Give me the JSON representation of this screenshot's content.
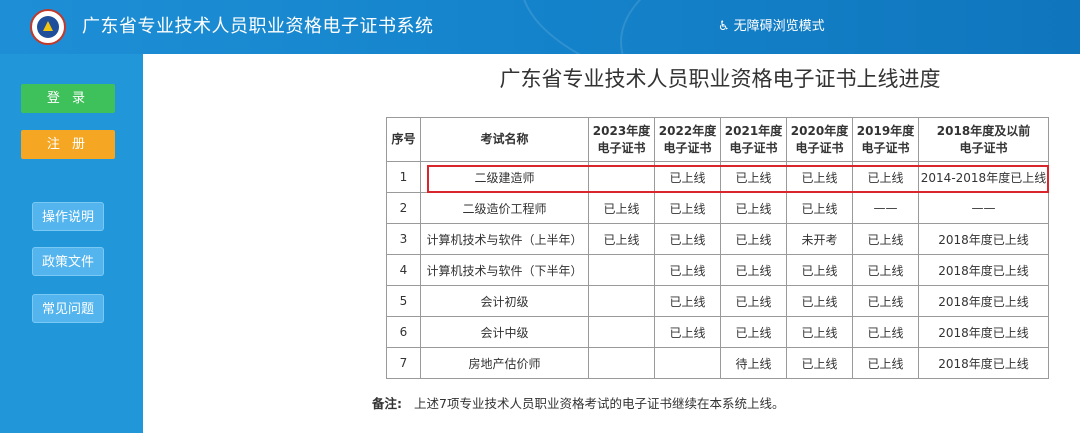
{
  "header": {
    "title": "广东省专业技术人员职业资格电子证书系统",
    "accessibility_label": "无障碍浏览模式"
  },
  "sidebar": {
    "login_label": "登 录",
    "register_label": "注 册",
    "nav": [
      "操作说明",
      "政策文件",
      "常见问题"
    ]
  },
  "main": {
    "title": "广东省专业技术人员职业资格电子证书上线进度",
    "table": {
      "headers": [
        {
          "line1": "序号",
          "line2": ""
        },
        {
          "line1": "考试名称",
          "line2": ""
        },
        {
          "line1": "2023年度",
          "line2": "电子证书"
        },
        {
          "line1": "2022年度",
          "line2": "电子证书"
        },
        {
          "line1": "2021年度",
          "line2": "电子证书"
        },
        {
          "line1": "2020年度",
          "line2": "电子证书"
        },
        {
          "line1": "2019年度",
          "line2": "电子证书"
        },
        {
          "line1": "2018年度及以前",
          "line2": "电子证书"
        }
      ],
      "rows": [
        [
          "1",
          "二级建造师",
          "",
          "已上线",
          "已上线",
          "已上线",
          "已上线",
          "2014-2018年度已上线"
        ],
        [
          "2",
          "二级造价工程师",
          "已上线",
          "已上线",
          "已上线",
          "已上线",
          "——",
          "——"
        ],
        [
          "3",
          "计算机技术与软件（上半年）",
          "已上线",
          "已上线",
          "已上线",
          "未开考",
          "已上线",
          "2018年度已上线"
        ],
        [
          "4",
          "计算机技术与软件（下半年）",
          "",
          "已上线",
          "已上线",
          "已上线",
          "已上线",
          "2018年度已上线"
        ],
        [
          "5",
          "会计初级",
          "",
          "已上线",
          "已上线",
          "已上线",
          "已上线",
          "2018年度已上线"
        ],
        [
          "6",
          "会计中级",
          "",
          "已上线",
          "已上线",
          "已上线",
          "已上线",
          "2018年度已上线"
        ],
        [
          "7",
          "房地产估价师",
          "",
          "",
          "待上线",
          "已上线",
          "已上线",
          "2018年度已上线"
        ]
      ]
    },
    "note_label": "备注:",
    "note_text": "上述7项专业技术人员职业资格考试的电子证书继续在本系统上线。"
  },
  "colors": {
    "header_blue": "#1584cc",
    "sidebar_blue": "#2196d9",
    "login_green": "#3ec05a",
    "register_orange": "#f5a623",
    "highlight_red": "#d9262c"
  }
}
